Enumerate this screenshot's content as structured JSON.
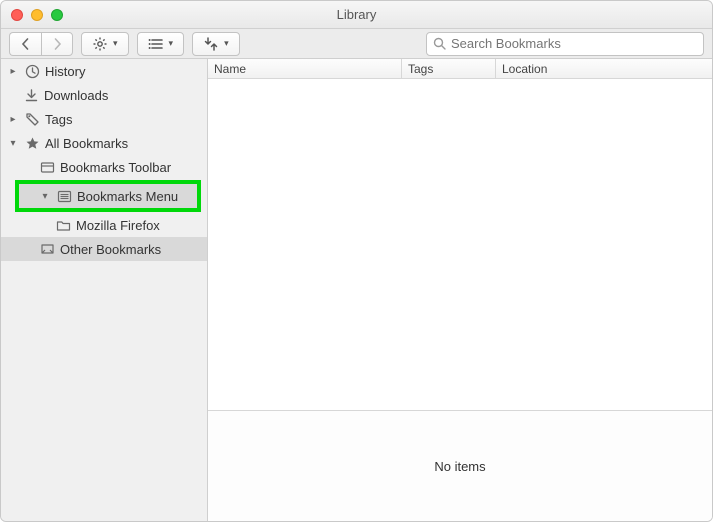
{
  "window": {
    "title": "Library"
  },
  "toolbar": {
    "search_placeholder": "Search Bookmarks"
  },
  "sidebar": {
    "items": [
      {
        "label": "History"
      },
      {
        "label": "Downloads"
      },
      {
        "label": "Tags"
      },
      {
        "label": "All Bookmarks"
      },
      {
        "label": "Bookmarks Toolbar"
      },
      {
        "label": "Bookmarks Menu"
      },
      {
        "label": "Mozilla Firefox"
      },
      {
        "label": "Other Bookmarks"
      }
    ]
  },
  "columns": {
    "name": "Name",
    "tags": "Tags",
    "location": "Location"
  },
  "footer": {
    "empty": "No items"
  }
}
